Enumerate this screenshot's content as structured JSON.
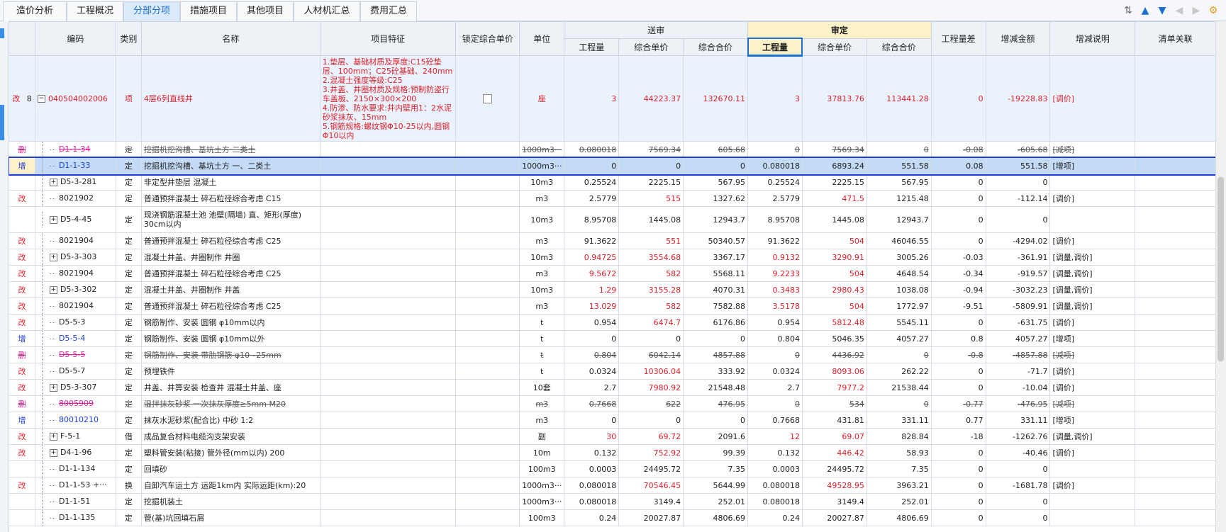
{
  "tabs": [
    {
      "label": "造价分析",
      "active": false
    },
    {
      "label": "工程概况",
      "active": false
    },
    {
      "label": "分部分项",
      "active": true
    },
    {
      "label": "措施项目",
      "active": false
    },
    {
      "label": "其他项目",
      "active": false
    },
    {
      "label": "人材机汇总",
      "active": false
    },
    {
      "label": "费用汇总",
      "active": false
    }
  ],
  "headers": {
    "code": "编码",
    "type": "类别",
    "name": "名称",
    "feature": "项目特征",
    "lock": "锁定综合单价",
    "unit": "单位",
    "songshen": "送审",
    "shending": "审定",
    "qty": "工程量",
    "uprice": "综合单价",
    "total": "综合合价",
    "qtydiff": "工程量差",
    "diffamt": "增减金额",
    "diffnote": "增减说明",
    "link": "清单关联"
  },
  "main_row": {
    "status": "改",
    "no": "8",
    "code": "040504002006",
    "type": "项",
    "name": "4层6列直线井",
    "feature": "1.垫层、基础材质及厚度:C15砼垫层、100mm；C25砼基础、240mm\n2.混凝土强度等级:C25\n3.井盖、井圈材质及规格:预制防盗行车盖板、2150×300×200\n4.防渗、防水要求:井内壁用1：2水泥砂浆抹灰、15mm\n5.钢筋规格:螺纹钢Φ10-25以内,圆钢Φ10以内",
    "unit": "座",
    "s_qty": "3",
    "s_up": "44223.37",
    "s_tot": "132670.11",
    "d_qty": "3",
    "d_up": "37813.76",
    "d_tot": "113441.28",
    "qtydiff": "0",
    "diffamt": "-19228.83",
    "note": "[调价]"
  },
  "rows": [
    {
      "status": "删",
      "code": "D1-1-34",
      "type": "定",
      "name": "挖掘机挖沟槽、基坑土方 二类土",
      "unit": "1000m3···",
      "s_qty": "0.080018",
      "s_up": "7569.34",
      "s_tot": "605.68",
      "d_qty": "0",
      "d_up": "7569.34",
      "d_tot": "0",
      "qtydiff": "-0.08",
      "diffamt": "-605.68",
      "note": "[减项]",
      "kind": "del"
    },
    {
      "status": "增",
      "code": "D1-1-33",
      "type": "定",
      "name": "挖掘机挖沟槽、基坑土方 一、二类土",
      "unit": "1000m3···",
      "s_qty": "0",
      "s_up": "0",
      "s_tot": "0",
      "d_qty": "0.080018",
      "d_up": "6893.24",
      "d_tot": "551.58",
      "qtydiff": "0.08",
      "diffamt": "551.58",
      "note": "[增项]",
      "kind": "sel"
    },
    {
      "status": "",
      "code": "D5-3-281",
      "type": "定",
      "name": "非定型井垫层 混凝土",
      "unit": "10m3",
      "s_qty": "0.25524",
      "s_up": "2225.15",
      "s_tot": "567.95",
      "d_qty": "0.25524",
      "d_up": "2225.15",
      "d_tot": "567.95",
      "qtydiff": "0",
      "diffamt": "0",
      "note": "",
      "kind": "plus"
    },
    {
      "status": "改",
      "code": "8021902",
      "type": "定",
      "name": "普通预拌混凝土 碎石粒径综合考虑 C15",
      "unit": "m3",
      "s_qty": "2.5779",
      "s_up": "515",
      "s_tot": "1327.62",
      "d_qty": "2.5779",
      "d_up": "471.5",
      "d_tot": "1215.48",
      "qtydiff": "0",
      "diffamt": "-112.14",
      "note": "[调价]",
      "kind": "",
      "red": [
        "s_up",
        "d_up"
      ]
    },
    {
      "status": "",
      "code": "D5-4-45",
      "type": "定",
      "name": "现浇钢筋混凝土池 池壁(隔墙) 直、矩形(厚度) 30cm以内",
      "unit": "10m3",
      "s_qty": "8.95708",
      "s_up": "1445.08",
      "s_tot": "12943.7",
      "d_qty": "8.95708",
      "d_up": "1445.08",
      "d_tot": "12943.7",
      "qtydiff": "0",
      "diffamt": "0",
      "note": "",
      "kind": "plus",
      "tall": true
    },
    {
      "status": "改",
      "code": "8021904",
      "type": "定",
      "name": "普通预拌混凝土 碎石粒径综合考虑 C25",
      "unit": "m3",
      "s_qty": "91.3622",
      "s_up": "551",
      "s_tot": "50340.57",
      "d_qty": "91.3622",
      "d_up": "504",
      "d_tot": "46046.55",
      "qtydiff": "0",
      "diffamt": "-4294.02",
      "note": "[调价]",
      "kind": "",
      "red": [
        "s_up",
        "d_up"
      ]
    },
    {
      "status": "改",
      "code": "D5-3-303",
      "type": "定",
      "name": "混凝土井盖、井圈制作 井圈",
      "unit": "10m3",
      "s_qty": "0.94725",
      "s_up": "3554.68",
      "s_tot": "3367.17",
      "d_qty": "0.9132",
      "d_up": "3290.91",
      "d_tot": "3005.26",
      "qtydiff": "-0.03",
      "diffamt": "-361.91",
      "note": "[调量,调价]",
      "kind": "plus",
      "red": [
        "s_qty",
        "s_up",
        "d_qty",
        "d_up"
      ]
    },
    {
      "status": "改",
      "code": "8021904",
      "type": "定",
      "name": "普通预拌混凝土 碎石粒径综合考虑 C25",
      "unit": "m3",
      "s_qty": "9.5672",
      "s_up": "582",
      "s_tot": "5568.11",
      "d_qty": "9.2233",
      "d_up": "504",
      "d_tot": "4648.54",
      "qtydiff": "-0.34",
      "diffamt": "-919.57",
      "note": "[调量,调价]",
      "kind": "",
      "red": [
        "s_qty",
        "s_up",
        "d_qty",
        "d_up"
      ]
    },
    {
      "status": "改",
      "code": "D5-3-302",
      "type": "定",
      "name": "混凝土井盖、井圈制作 井盖",
      "unit": "10m3",
      "s_qty": "1.29",
      "s_up": "3155.28",
      "s_tot": "4070.31",
      "d_qty": "0.3483",
      "d_up": "2980.43",
      "d_tot": "1038.08",
      "qtydiff": "-0.94",
      "diffamt": "-3032.23",
      "note": "[调量,调价]",
      "kind": "plus",
      "red": [
        "s_qty",
        "s_up",
        "d_qty",
        "d_up"
      ]
    },
    {
      "status": "改",
      "code": "8021904",
      "type": "定",
      "name": "普通预拌混凝土 碎石粒径综合考虑 C25",
      "unit": "m3",
      "s_qty": "13.029",
      "s_up": "582",
      "s_tot": "7582.88",
      "d_qty": "3.5178",
      "d_up": "504",
      "d_tot": "1772.97",
      "qtydiff": "-9.51",
      "diffamt": "-5809.91",
      "note": "[调量,调价]",
      "kind": "",
      "red": [
        "s_qty",
        "s_up",
        "d_qty",
        "d_up"
      ]
    },
    {
      "status": "改",
      "code": "D5-5-3",
      "type": "定",
      "name": "钢筋制作、安装 圆钢 φ10mm以内",
      "unit": "t",
      "s_qty": "0.954",
      "s_up": "6474.7",
      "s_tot": "6176.86",
      "d_qty": "0.954",
      "d_up": "5812.48",
      "d_tot": "5545.11",
      "qtydiff": "0",
      "diffamt": "-631.75",
      "note": "[调价]",
      "kind": "",
      "red": [
        "s_up",
        "d_up"
      ]
    },
    {
      "status": "增",
      "code": "D5-5-4",
      "type": "定",
      "name": "钢筋制作、安装 圆钢 φ10mm以外",
      "unit": "t",
      "s_qty": "0",
      "s_up": "0",
      "s_tot": "0",
      "d_qty": "0.804",
      "d_up": "5046.35",
      "d_tot": "4057.27",
      "qtydiff": "0.8",
      "diffamt": "4057.27",
      "note": "[增项]",
      "kind": "add"
    },
    {
      "status": "删",
      "code": "D5-5-5",
      "type": "定",
      "name": "钢筋制作、安装 带肋钢筋 φ10~25mm",
      "unit": "t",
      "s_qty": "0.804",
      "s_up": "6042.14",
      "s_tot": "4857.88",
      "d_qty": "0",
      "d_up": "4436.92",
      "d_tot": "0",
      "qtydiff": "-0.8",
      "diffamt": "-4857.88",
      "note": "[减项]",
      "kind": "del"
    },
    {
      "status": "改",
      "code": "D5-5-7",
      "type": "定",
      "name": "预埋铁件",
      "unit": "t",
      "s_qty": "0.0324",
      "s_up": "10306.04",
      "s_tot": "333.92",
      "d_qty": "0.0324",
      "d_up": "8093.06",
      "d_tot": "262.22",
      "qtydiff": "0",
      "diffamt": "-71.7",
      "note": "[调价]",
      "kind": "",
      "red": [
        "s_up",
        "d_up"
      ]
    },
    {
      "status": "改",
      "code": "D5-3-307",
      "type": "定",
      "name": "井盖、井箅安装 检查井 混凝土井盖、座",
      "unit": "10套",
      "s_qty": "2.7",
      "s_up": "7980.92",
      "s_tot": "21548.48",
      "d_qty": "2.7",
      "d_up": "7977.2",
      "d_tot": "21538.44",
      "qtydiff": "0",
      "diffamt": "-10.04",
      "note": "[调价]",
      "kind": "plus",
      "red": [
        "s_up",
        "d_up"
      ]
    },
    {
      "status": "删",
      "code": "8005909",
      "type": "定",
      "name": "湿拌抹灰砂浆 一次抹灰厚度≥5mm M20",
      "unit": "m3",
      "s_qty": "0.7668",
      "s_up": "622",
      "s_tot": "476.95",
      "d_qty": "0",
      "d_up": "534",
      "d_tot": "0",
      "qtydiff": "-0.77",
      "diffamt": "-476.95",
      "note": "[减项]",
      "kind": "del"
    },
    {
      "status": "增",
      "code": "80010210",
      "type": "定",
      "name": "抹灰水泥砂浆(配合比) 中砂 1:2",
      "unit": "m3",
      "s_qty": "0",
      "s_up": "0",
      "s_tot": "0",
      "d_qty": "0.7668",
      "d_up": "431.81",
      "d_tot": "331.11",
      "qtydiff": "0.77",
      "diffamt": "331.11",
      "note": "[增项]",
      "kind": "add"
    },
    {
      "status": "改",
      "code": "F-5-1",
      "type": "借",
      "name": "成品复合材料电缆沟支架安装",
      "unit": "副",
      "s_qty": "30",
      "s_up": "69.72",
      "s_tot": "2091.6",
      "d_qty": "12",
      "d_up": "69.07",
      "d_tot": "828.84",
      "qtydiff": "-18",
      "diffamt": "-1262.76",
      "note": "[调量,调价]",
      "kind": "plus",
      "red": [
        "s_qty",
        "s_up",
        "d_qty",
        "d_up"
      ]
    },
    {
      "status": "改",
      "code": "D4-1-96",
      "type": "定",
      "name": "塑料管安装(粘接) 管外径(mm以内) 200",
      "unit": "10m",
      "s_qty": "0.132",
      "s_up": "752.92",
      "s_tot": "99.39",
      "d_qty": "0.132",
      "d_up": "446.42",
      "d_tot": "58.93",
      "qtydiff": "0",
      "diffamt": "-40.46",
      "note": "[调价]",
      "kind": "plus",
      "red": [
        "s_up",
        "d_up"
      ]
    },
    {
      "status": "",
      "code": "D1-1-134",
      "type": "定",
      "name": "回填砂",
      "unit": "100m3",
      "s_qty": "0.0003",
      "s_up": "24495.72",
      "s_tot": "7.35",
      "d_qty": "0.0003",
      "d_up": "24495.72",
      "d_tot": "7.35",
      "qtydiff": "0",
      "diffamt": "0",
      "note": "",
      "kind": ""
    },
    {
      "status": "改",
      "code": "D1-1-53 +···",
      "type": "换",
      "name": "自卸汽车运土方 运距1km内  实际运距(km):20",
      "unit": "1000m3···",
      "s_qty": "0.080018",
      "s_up": "70546.45",
      "s_tot": "5644.99",
      "d_qty": "0.080018",
      "d_up": "49528.95",
      "d_tot": "3963.21",
      "qtydiff": "0",
      "diffamt": "-1681.78",
      "note": "[调价]",
      "kind": "",
      "red": [
        "s_up",
        "d_up"
      ]
    },
    {
      "status": "",
      "code": "D1-1-51",
      "type": "定",
      "name": "挖掘机装土",
      "unit": "1000m3···",
      "s_qty": "0.080018",
      "s_up": "3149.4",
      "s_tot": "252.01",
      "d_qty": "0.080018",
      "d_up": "3149.4",
      "d_tot": "252.01",
      "qtydiff": "0",
      "diffamt": "0",
      "note": "",
      "kind": ""
    },
    {
      "status": "",
      "code": "D1-1-135",
      "type": "定",
      "name": "管(基)坑回填石屑",
      "unit": "100m3",
      "s_qty": "0.24",
      "s_up": "20027.87",
      "s_tot": "4806.69",
      "d_qty": "0.24",
      "d_up": "20027.87",
      "d_tot": "4806.69",
      "qtydiff": "0",
      "diffamt": "0",
      "note": "",
      "kind": ""
    }
  ]
}
